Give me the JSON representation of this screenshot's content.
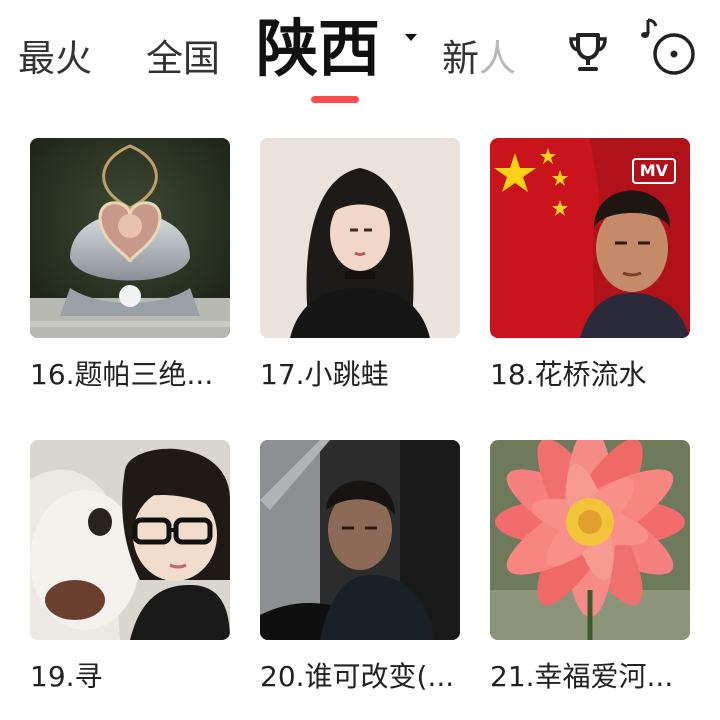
{
  "header": {
    "tabs": [
      "最火",
      "全国",
      "陕西",
      "新人"
    ],
    "active_tab": "陕西",
    "new_tab_main": "新",
    "new_tab_fade": "人",
    "icons": [
      "trophy-icon",
      "music-disc-icon"
    ],
    "accent_color": "#ff4d4f"
  },
  "songs": [
    {
      "title": "16.题帕三绝...",
      "badge": ""
    },
    {
      "title": "17.小跳蛙",
      "badge": ""
    },
    {
      "title": "18.花桥流水",
      "badge": "MV"
    },
    {
      "title": "19.寻",
      "badge": ""
    },
    {
      "title": "20.谁可改变(...",
      "badge": ""
    },
    {
      "title": "21.幸福爱河...",
      "badge": ""
    }
  ]
}
